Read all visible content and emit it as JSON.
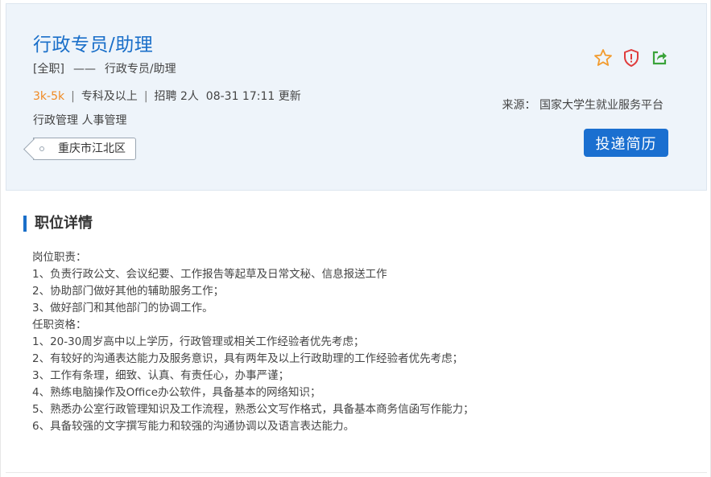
{
  "job": {
    "title": "行政专员/助理",
    "employment_type": "[全职]",
    "dash": "——",
    "category_name": "行政专员/助理",
    "salary": "3k-5k",
    "education": "专科及以上",
    "headcount": "招聘 2人",
    "updated": "08-31 17:11 更新",
    "tags": "行政管理 人事管理",
    "location": "重庆市江北区",
    "source": "来源： 国家大学生就业服务平台",
    "apply_label": "投递简历"
  },
  "icons": {
    "favorite": "star-icon",
    "report": "shield-alert-icon",
    "share": "share-icon"
  },
  "colors": {
    "accent": "#1a6fc9",
    "salary": "#f08a24",
    "star": "#f29b2e",
    "report": "#e03c3c",
    "share": "#3aa33a"
  },
  "detail": {
    "heading": "职位详情",
    "lines": [
      "岗位职责：",
      "1、负责行政公文、会议纪要、工作报告等起草及日常文秘、信息报送工作",
      "2、协助部门做好其他的辅助服务工作；",
      "3、做好部门和其他部门的协调工作。",
      "任职资格：",
      "1、20-30周岁高中以上学历，行政管理或相关工作经验者优先考虑；",
      "2、有较好的沟通表达能力及服务意识，具有两年及以上行政助理的工作经验者优先考虑；",
      "3、工作有条理，细致、认真、有责任心，办事严谨；",
      "4、熟练电脑操作及Office办公软件，具备基本的网络知识；",
      "5、熟悉办公室行政管理知识及工作流程，熟悉公文写作格式，具备基本商务信函写作能力；",
      "6、具备较强的文字撰写能力和较强的沟通协调以及语言表达能力。"
    ]
  }
}
